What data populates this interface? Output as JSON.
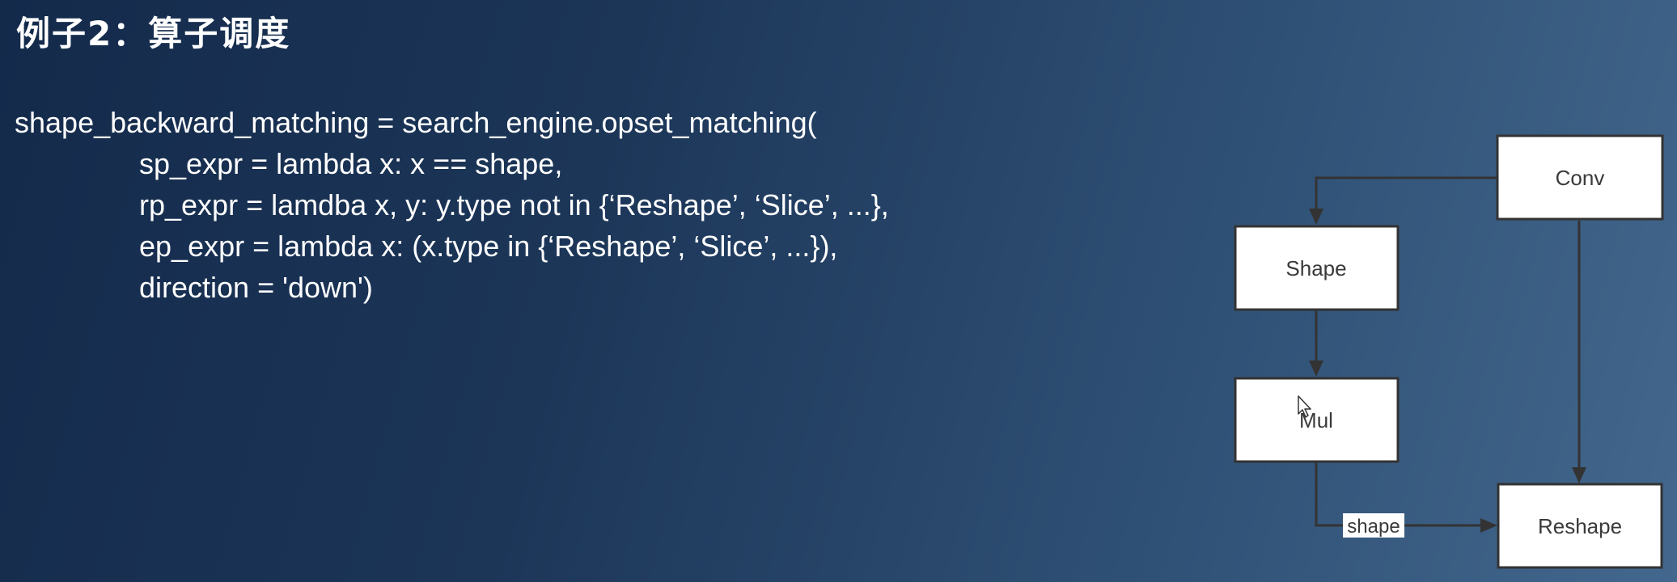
{
  "title": "例子2：算子调度",
  "code": {
    "lines": [
      "shape_backward_matching = search_engine.opset_matching(",
      "sp_expr = lambda x: x == shape,",
      "rp_expr = lamdba x, y: y.type not in {‘Reshape’, ‘Slice’, ...},",
      "ep_expr = lambda x: (x.type in {‘Reshape’, ‘Slice’, ...}),",
      "direction = 'down')"
    ]
  },
  "diagram": {
    "nodes": {
      "conv": "Conv",
      "shape": "Shape",
      "mul": "Mul",
      "reshape": "Reshape"
    },
    "edge_labels": {
      "mul_to_reshape": "shape"
    }
  },
  "colors": {
    "background_start": "#142a4b",
    "background_end": "#43678d",
    "node_fill": "#ffffff",
    "node_border": "#333333"
  }
}
